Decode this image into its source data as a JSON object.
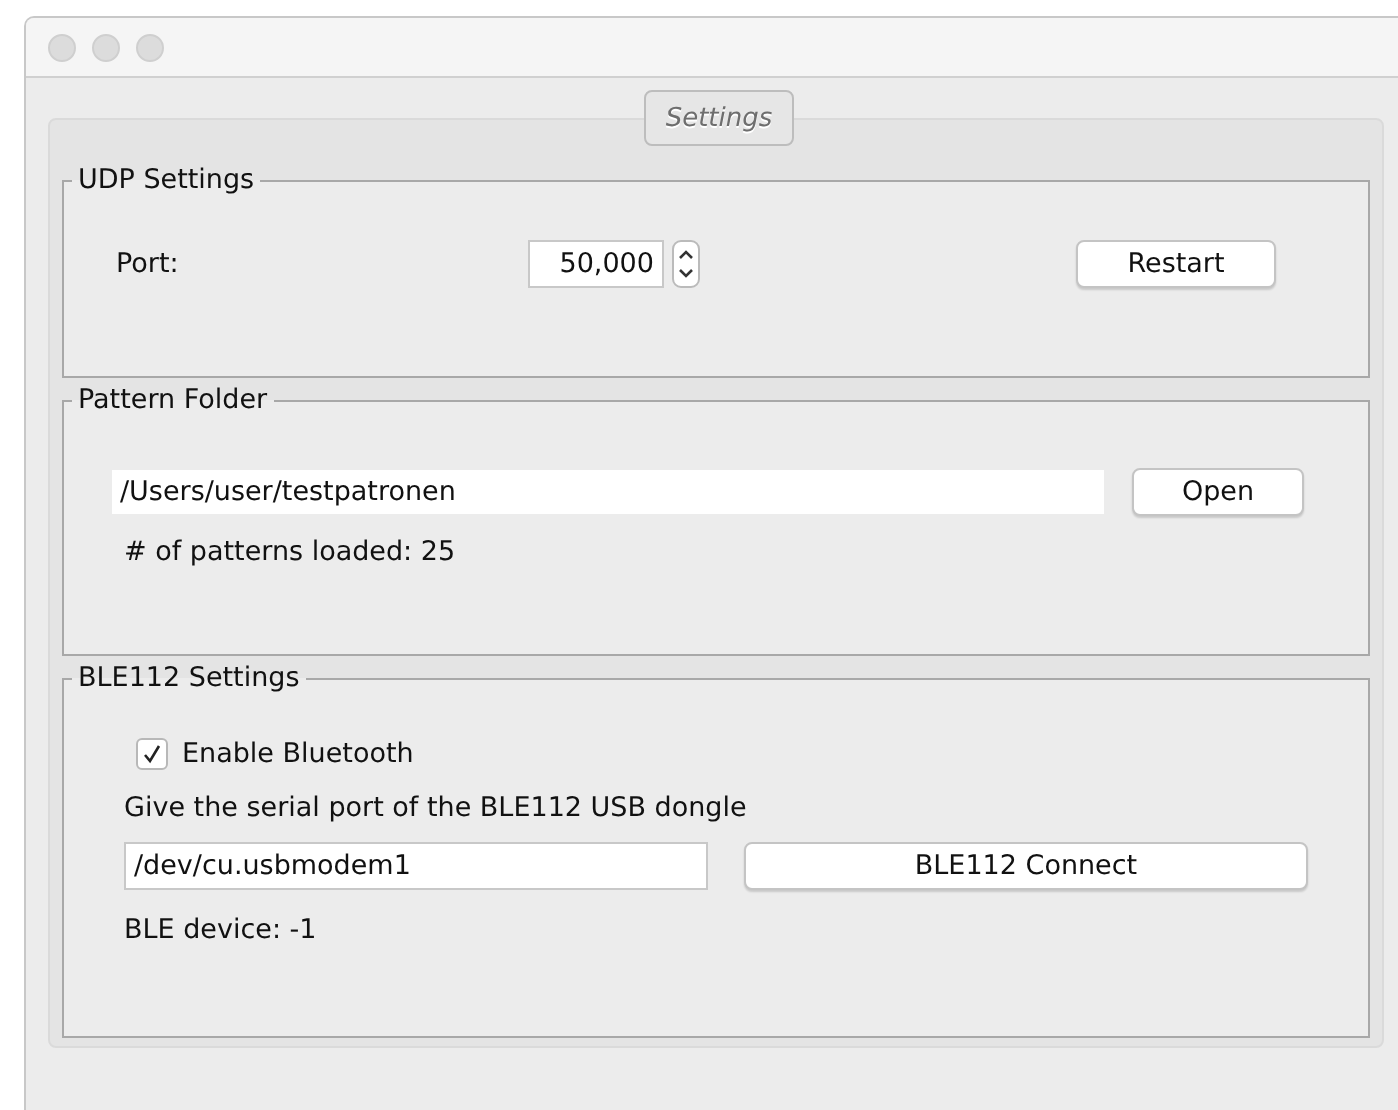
{
  "tabs": [
    {
      "label": "Settings",
      "selected": true
    }
  ],
  "udp": {
    "title": "UDP Settings",
    "port_label": "Port:",
    "port_value": "50,000",
    "restart": "Restart"
  },
  "pattern": {
    "title": "Pattern Folder",
    "path": "/Users/user/testpatronen",
    "open": "Open",
    "loaded": "# of patterns loaded: 25"
  },
  "ble": {
    "title": "BLE112 Settings",
    "enable": {
      "label": "Enable Bluetooth",
      "checked": true
    },
    "hint": "Give the serial port of the BLE112 USB dongle",
    "port": "/dev/cu.usbmodem1",
    "connect": "BLE112 Connect",
    "device": "BLE device: -1"
  }
}
